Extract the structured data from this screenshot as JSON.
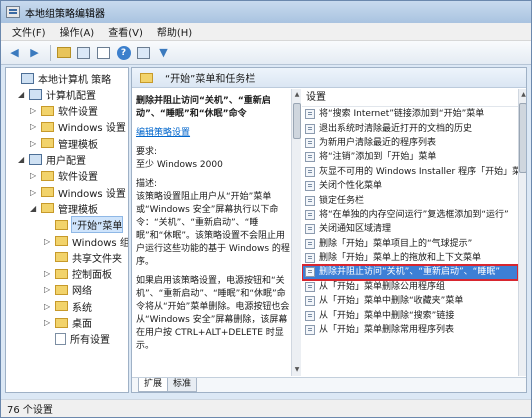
{
  "window": {
    "title": "本地组策略编辑器"
  },
  "menu": [
    "文件(F)",
    "操作(A)",
    "查看(V)",
    "帮助(H)"
  ],
  "toolbar": {
    "icons": [
      "back-icon",
      "forward-icon",
      "folder-up-icon",
      "show-hide-tree-icon",
      "export-icon",
      "help-icon",
      "properties-icon",
      "filter-icon"
    ]
  },
  "tree": [
    {
      "label": "本地计算机 策略",
      "level": 0,
      "twisty": "",
      "icon": "pc"
    },
    {
      "label": "计算机配置",
      "level": 1,
      "twisty": "◢",
      "icon": "pc"
    },
    {
      "label": "软件设置",
      "level": 2,
      "twisty": "▷",
      "icon": "folder"
    },
    {
      "label": "Windows 设置",
      "level": 2,
      "twisty": "▷",
      "icon": "folder"
    },
    {
      "label": "管理模板",
      "level": 2,
      "twisty": "▷",
      "icon": "folder"
    },
    {
      "label": "用户配置",
      "level": 1,
      "twisty": "◢",
      "icon": "pc"
    },
    {
      "label": "软件设置",
      "level": 2,
      "twisty": "▷",
      "icon": "folder"
    },
    {
      "label": "Windows 设置",
      "level": 2,
      "twisty": "▷",
      "icon": "folder"
    },
    {
      "label": "管理模板",
      "level": 2,
      "twisty": "◢",
      "icon": "folder"
    },
    {
      "label": "“开始”菜单",
      "level": 3,
      "twisty": "",
      "icon": "folder",
      "selected": true
    },
    {
      "label": "Windows 组件",
      "level": 3,
      "twisty": "▷",
      "icon": "folder"
    },
    {
      "label": "共享文件夹",
      "level": 3,
      "twisty": "",
      "icon": "folder"
    },
    {
      "label": "控制面板",
      "level": 3,
      "twisty": "▷",
      "icon": "folder"
    },
    {
      "label": "网络",
      "level": 3,
      "twisty": "▷",
      "icon": "folder"
    },
    {
      "label": "系统",
      "level": 3,
      "twisty": "▷",
      "icon": "folder"
    },
    {
      "label": "桌面",
      "level": 3,
      "twisty": "▷",
      "icon": "folder"
    },
    {
      "label": "所有设置",
      "level": 3,
      "twisty": "",
      "icon": "page"
    }
  ],
  "detail": {
    "header": "“开始”菜单和任务栏",
    "desc_title": "删除并阻止访问“关机”、“重新启动”、“睡眠”和“休眠”命令",
    "edit_link_prefix": "编辑",
    "edit_link": "策略设置",
    "req_label": "要求:",
    "req_value": "至少 Windows 2000",
    "desc_label": "描述:",
    "desc_body": "该策略设置阻止用户从“开始”菜单或“Windows 安全”屏幕执行以下命令：“关机”、“重新启动”、“睡眠”和“休眠”。该策略设置不会阻止用户运行这些功能的基于 Windows 的程序。",
    "desc_body2": "如果启用该策略设置，电源按钮和“关机”、“重新启动”、“睡眠”和“休眠”命令将从“开始”菜单删除。电源按钮也会从“Windows 安全”屏幕删除，该屏幕在用户按 CTRL+ALT+DELETE 时显示。",
    "list_header": "设置",
    "list": [
      "将“搜索 Internet”链接添加到“开始”菜单",
      "退出系统时清除最近打开的文档的历史",
      "为新用户清除最近的程序列表",
      "将“注销”添加到「开始」菜单",
      "灰显不可用的 Windows Installer 程序「开始」菜单",
      "关闭个性化菜单",
      "锁定任务栏",
      "将“在单独的内存空间运行”复选框添加到“运行”",
      "关闭通知区域清理",
      "删除「开始」菜单项目上的“气球提示”",
      "删除「开始」菜单上的拖放和上下文菜单",
      "删除并阻止访问“关机”、“重新启动”、“睡眠”",
      "从「开始」菜单删除公用程序组",
      "从「开始」菜单中删除“收藏夹”菜单",
      "从「开始」菜单中删除“搜索”链接",
      "从「开始」菜单删除常用程序列表"
    ],
    "selected_index": 11,
    "tabs": [
      "扩展",
      "标准"
    ]
  },
  "status": "76 个设置"
}
